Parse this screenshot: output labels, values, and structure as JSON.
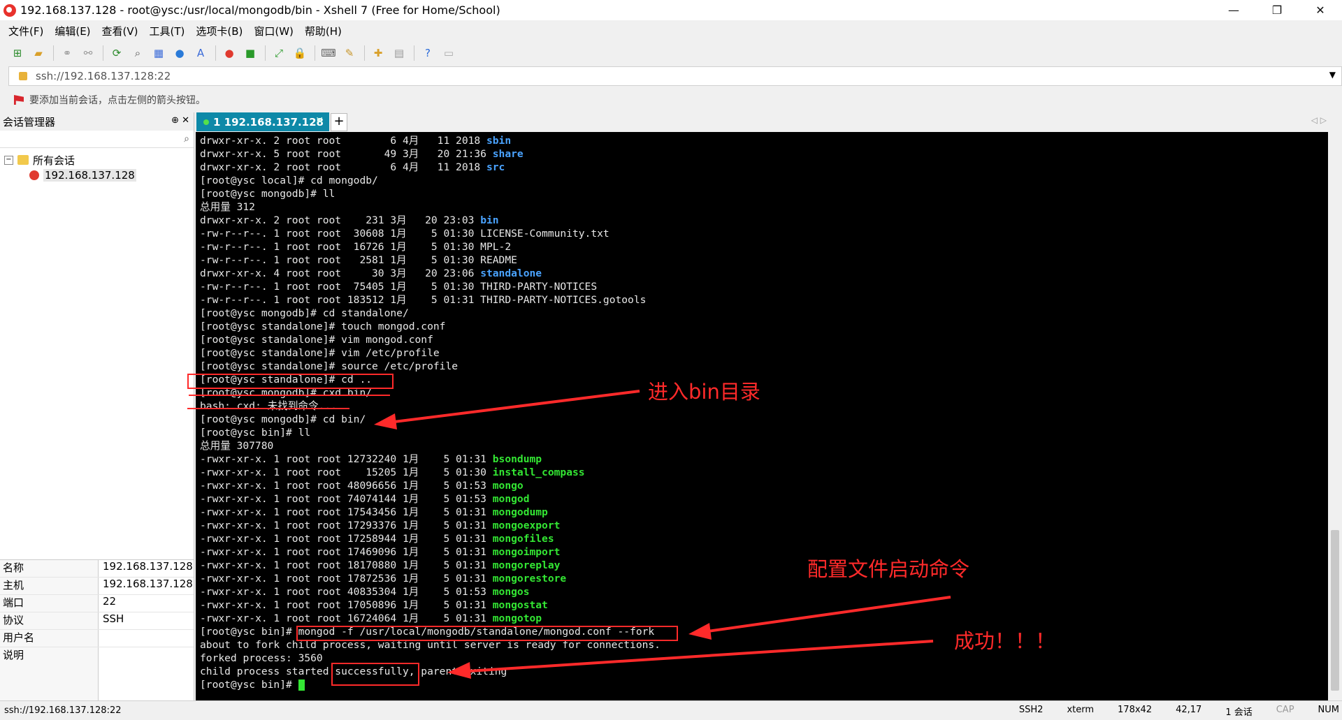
{
  "window": {
    "title": "192.168.137.128 - root@ysc:/usr/local/mongodb/bin - Xshell 7 (Free for Home/School)"
  },
  "menu": [
    "文件(F)",
    "编辑(E)",
    "查看(V)",
    "工具(T)",
    "选项卡(B)",
    "窗口(W)",
    "帮助(H)"
  ],
  "address": {
    "value": "ssh://192.168.137.128:22"
  },
  "hint": "要添加当前会话，点击左侧的箭头按钮。",
  "sidebar": {
    "title": "会话管理器",
    "tree": {
      "root": "所有会话",
      "session": "192.168.137.128"
    },
    "props": [
      {
        "k": "名称",
        "v": "192.168.137.128"
      },
      {
        "k": "主机",
        "v": "192.168.137.128"
      },
      {
        "k": "端口",
        "v": "22"
      },
      {
        "k": "协议",
        "v": "SSH"
      },
      {
        "k": "用户名",
        "v": ""
      },
      {
        "k": "说明",
        "v": ""
      }
    ]
  },
  "tab": {
    "label": "1 192.168.137.128",
    "add": "+"
  },
  "terminal": {
    "lines": [
      {
        "p": "drwxr-xr-x. 2 root root        6 4月   11 2018 ",
        "h": "sbin",
        "c": "blue"
      },
      {
        "p": "drwxr-xr-x. 5 root root       49 3月   20 21:36 ",
        "h": "share",
        "c": "blue"
      },
      {
        "p": "drwxr-xr-x. 2 root root        6 4月   11 2018 ",
        "h": "src",
        "c": "blue"
      },
      {
        "p": "[root@ysc local]# cd mongodb/"
      },
      {
        "p": "[root@ysc mongodb]# ll"
      },
      {
        "p": "总用量 312"
      },
      {
        "p": "drwxr-xr-x. 2 root root    231 3月   20 23:03 ",
        "h": "bin",
        "c": "blue"
      },
      {
        "p": "-rw-r--r--. 1 root root  30608 1月    5 01:30 LICENSE-Community.txt"
      },
      {
        "p": "-rw-r--r--. 1 root root  16726 1月    5 01:30 MPL-2"
      },
      {
        "p": "-rw-r--r--. 1 root root   2581 1月    5 01:30 README"
      },
      {
        "p": "drwxr-xr-x. 4 root root     30 3月   20 23:06 ",
        "h": "standalone",
        "c": "blue"
      },
      {
        "p": "-rw-r--r--. 1 root root  75405 1月    5 01:30 THIRD-PARTY-NOTICES"
      },
      {
        "p": "-rw-r--r--. 1 root root 183512 1月    5 01:31 THIRD-PARTY-NOTICES.gotools"
      },
      {
        "p": "[root@ysc mongodb]# cd standalone/"
      },
      {
        "p": "[root@ysc standalone]# touch mongod.conf"
      },
      {
        "p": "[root@ysc standalone]# vim mongod.conf"
      },
      {
        "p": "[root@ysc standalone]# vim /etc/profile"
      },
      {
        "p": "[root@ysc standalone]# source /etc/profile"
      },
      {
        "p": "[root@ysc standalone]# cd .."
      },
      {
        "p": "[root@ysc mongodb]# cxd bin/"
      },
      {
        "p": "bash: cxd: 未找到命令..."
      },
      {
        "p": "[root@ysc mongodb]# cd bin/"
      },
      {
        "p": "[root@ysc bin]# ll"
      },
      {
        "p": "总用量 307780"
      },
      {
        "p": "-rwxr-xr-x. 1 root root 12732240 1月    5 01:31 ",
        "h": "bsondump",
        "c": "green"
      },
      {
        "p": "-rwxr-xr-x. 1 root root    15205 1月    5 01:30 ",
        "h": "install_compass",
        "c": "green"
      },
      {
        "p": "-rwxr-xr-x. 1 root root 48096656 1月    5 01:53 ",
        "h": "mongo",
        "c": "green"
      },
      {
        "p": "-rwxr-xr-x. 1 root root 74074144 1月    5 01:53 ",
        "h": "mongod",
        "c": "green"
      },
      {
        "p": "-rwxr-xr-x. 1 root root 17543456 1月    5 01:31 ",
        "h": "mongodump",
        "c": "green"
      },
      {
        "p": "-rwxr-xr-x. 1 root root 17293376 1月    5 01:31 ",
        "h": "mongoexport",
        "c": "green"
      },
      {
        "p": "-rwxr-xr-x. 1 root root 17258944 1月    5 01:31 ",
        "h": "mongofiles",
        "c": "green"
      },
      {
        "p": "-rwxr-xr-x. 1 root root 17469096 1月    5 01:31 ",
        "h": "mongoimport",
        "c": "green"
      },
      {
        "p": "-rwxr-xr-x. 1 root root 18170880 1月    5 01:31 ",
        "h": "mongoreplay",
        "c": "green"
      },
      {
        "p": "-rwxr-xr-x. 1 root root 17872536 1月    5 01:31 ",
        "h": "mongorestore",
        "c": "green"
      },
      {
        "p": "-rwxr-xr-x. 1 root root 40835304 1月    5 01:53 ",
        "h": "mongos",
        "c": "green"
      },
      {
        "p": "-rwxr-xr-x. 1 root root 17050896 1月    5 01:31 ",
        "h": "mongostat",
        "c": "green"
      },
      {
        "p": "-rwxr-xr-x. 1 root root 16724064 1月    5 01:31 ",
        "h": "mongotop",
        "c": "green"
      },
      {
        "p": "[root@ysc bin]# mongod -f /usr/local/mongodb/standalone/mongod.conf --fork"
      },
      {
        "p": "about to fork child process, waiting until server is ready for connections."
      },
      {
        "p": "forked process: 3560"
      },
      {
        "p": "child process started successfully, parent exiting"
      },
      {
        "p": "[root@ysc bin]# ",
        "cursor": true
      }
    ]
  },
  "annotations": {
    "enter_bin": "进入bin目录",
    "config_start": "配置文件启动命令",
    "success": "成功！！！",
    "color": "#ff2a2a"
  },
  "status": {
    "left": "ssh://192.168.137.128:22",
    "items": [
      "SSH2",
      "xterm",
      "178x42",
      "42,17",
      "1 会话",
      "CAP",
      "NUM"
    ]
  }
}
